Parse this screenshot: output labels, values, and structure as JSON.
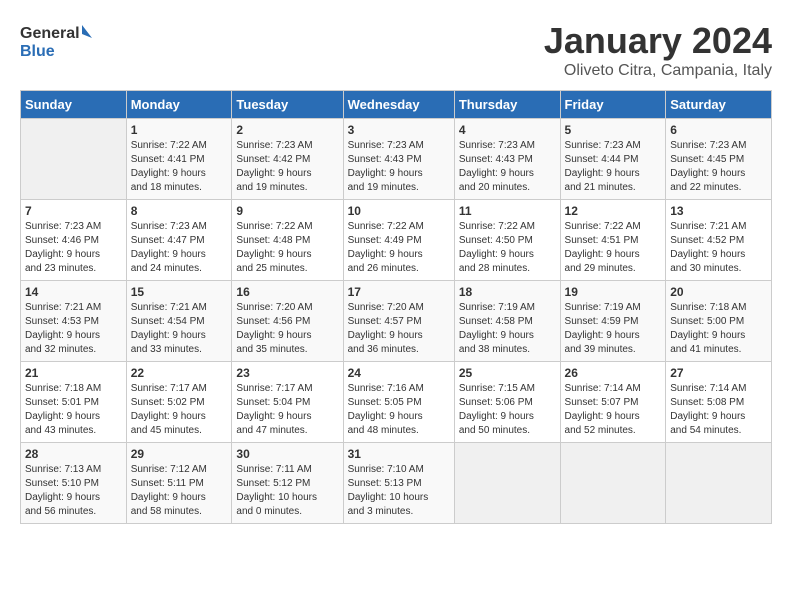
{
  "logo": {
    "text_general": "General",
    "text_blue": "Blue"
  },
  "header": {
    "title": "January 2024",
    "subtitle": "Oliveto Citra, Campania, Italy"
  },
  "weekdays": [
    "Sunday",
    "Monday",
    "Tuesday",
    "Wednesday",
    "Thursday",
    "Friday",
    "Saturday"
  ],
  "weeks": [
    [
      {
        "day": "",
        "detail": ""
      },
      {
        "day": "1",
        "detail": "Sunrise: 7:22 AM\nSunset: 4:41 PM\nDaylight: 9 hours\nand 18 minutes."
      },
      {
        "day": "2",
        "detail": "Sunrise: 7:23 AM\nSunset: 4:42 PM\nDaylight: 9 hours\nand 19 minutes."
      },
      {
        "day": "3",
        "detail": "Sunrise: 7:23 AM\nSunset: 4:43 PM\nDaylight: 9 hours\nand 19 minutes."
      },
      {
        "day": "4",
        "detail": "Sunrise: 7:23 AM\nSunset: 4:43 PM\nDaylight: 9 hours\nand 20 minutes."
      },
      {
        "day": "5",
        "detail": "Sunrise: 7:23 AM\nSunset: 4:44 PM\nDaylight: 9 hours\nand 21 minutes."
      },
      {
        "day": "6",
        "detail": "Sunrise: 7:23 AM\nSunset: 4:45 PM\nDaylight: 9 hours\nand 22 minutes."
      }
    ],
    [
      {
        "day": "7",
        "detail": "Sunrise: 7:23 AM\nSunset: 4:46 PM\nDaylight: 9 hours\nand 23 minutes."
      },
      {
        "day": "8",
        "detail": "Sunrise: 7:23 AM\nSunset: 4:47 PM\nDaylight: 9 hours\nand 24 minutes."
      },
      {
        "day": "9",
        "detail": "Sunrise: 7:22 AM\nSunset: 4:48 PM\nDaylight: 9 hours\nand 25 minutes."
      },
      {
        "day": "10",
        "detail": "Sunrise: 7:22 AM\nSunset: 4:49 PM\nDaylight: 9 hours\nand 26 minutes."
      },
      {
        "day": "11",
        "detail": "Sunrise: 7:22 AM\nSunset: 4:50 PM\nDaylight: 9 hours\nand 28 minutes."
      },
      {
        "day": "12",
        "detail": "Sunrise: 7:22 AM\nSunset: 4:51 PM\nDaylight: 9 hours\nand 29 minutes."
      },
      {
        "day": "13",
        "detail": "Sunrise: 7:21 AM\nSunset: 4:52 PM\nDaylight: 9 hours\nand 30 minutes."
      }
    ],
    [
      {
        "day": "14",
        "detail": "Sunrise: 7:21 AM\nSunset: 4:53 PM\nDaylight: 9 hours\nand 32 minutes."
      },
      {
        "day": "15",
        "detail": "Sunrise: 7:21 AM\nSunset: 4:54 PM\nDaylight: 9 hours\nand 33 minutes."
      },
      {
        "day": "16",
        "detail": "Sunrise: 7:20 AM\nSunset: 4:56 PM\nDaylight: 9 hours\nand 35 minutes."
      },
      {
        "day": "17",
        "detail": "Sunrise: 7:20 AM\nSunset: 4:57 PM\nDaylight: 9 hours\nand 36 minutes."
      },
      {
        "day": "18",
        "detail": "Sunrise: 7:19 AM\nSunset: 4:58 PM\nDaylight: 9 hours\nand 38 minutes."
      },
      {
        "day": "19",
        "detail": "Sunrise: 7:19 AM\nSunset: 4:59 PM\nDaylight: 9 hours\nand 39 minutes."
      },
      {
        "day": "20",
        "detail": "Sunrise: 7:18 AM\nSunset: 5:00 PM\nDaylight: 9 hours\nand 41 minutes."
      }
    ],
    [
      {
        "day": "21",
        "detail": "Sunrise: 7:18 AM\nSunset: 5:01 PM\nDaylight: 9 hours\nand 43 minutes."
      },
      {
        "day": "22",
        "detail": "Sunrise: 7:17 AM\nSunset: 5:02 PM\nDaylight: 9 hours\nand 45 minutes."
      },
      {
        "day": "23",
        "detail": "Sunrise: 7:17 AM\nSunset: 5:04 PM\nDaylight: 9 hours\nand 47 minutes."
      },
      {
        "day": "24",
        "detail": "Sunrise: 7:16 AM\nSunset: 5:05 PM\nDaylight: 9 hours\nand 48 minutes."
      },
      {
        "day": "25",
        "detail": "Sunrise: 7:15 AM\nSunset: 5:06 PM\nDaylight: 9 hours\nand 50 minutes."
      },
      {
        "day": "26",
        "detail": "Sunrise: 7:14 AM\nSunset: 5:07 PM\nDaylight: 9 hours\nand 52 minutes."
      },
      {
        "day": "27",
        "detail": "Sunrise: 7:14 AM\nSunset: 5:08 PM\nDaylight: 9 hours\nand 54 minutes."
      }
    ],
    [
      {
        "day": "28",
        "detail": "Sunrise: 7:13 AM\nSunset: 5:10 PM\nDaylight: 9 hours\nand 56 minutes."
      },
      {
        "day": "29",
        "detail": "Sunrise: 7:12 AM\nSunset: 5:11 PM\nDaylight: 9 hours\nand 58 minutes."
      },
      {
        "day": "30",
        "detail": "Sunrise: 7:11 AM\nSunset: 5:12 PM\nDaylight: 10 hours\nand 0 minutes."
      },
      {
        "day": "31",
        "detail": "Sunrise: 7:10 AM\nSunset: 5:13 PM\nDaylight: 10 hours\nand 3 minutes."
      },
      {
        "day": "",
        "detail": ""
      },
      {
        "day": "",
        "detail": ""
      },
      {
        "day": "",
        "detail": ""
      }
    ]
  ]
}
